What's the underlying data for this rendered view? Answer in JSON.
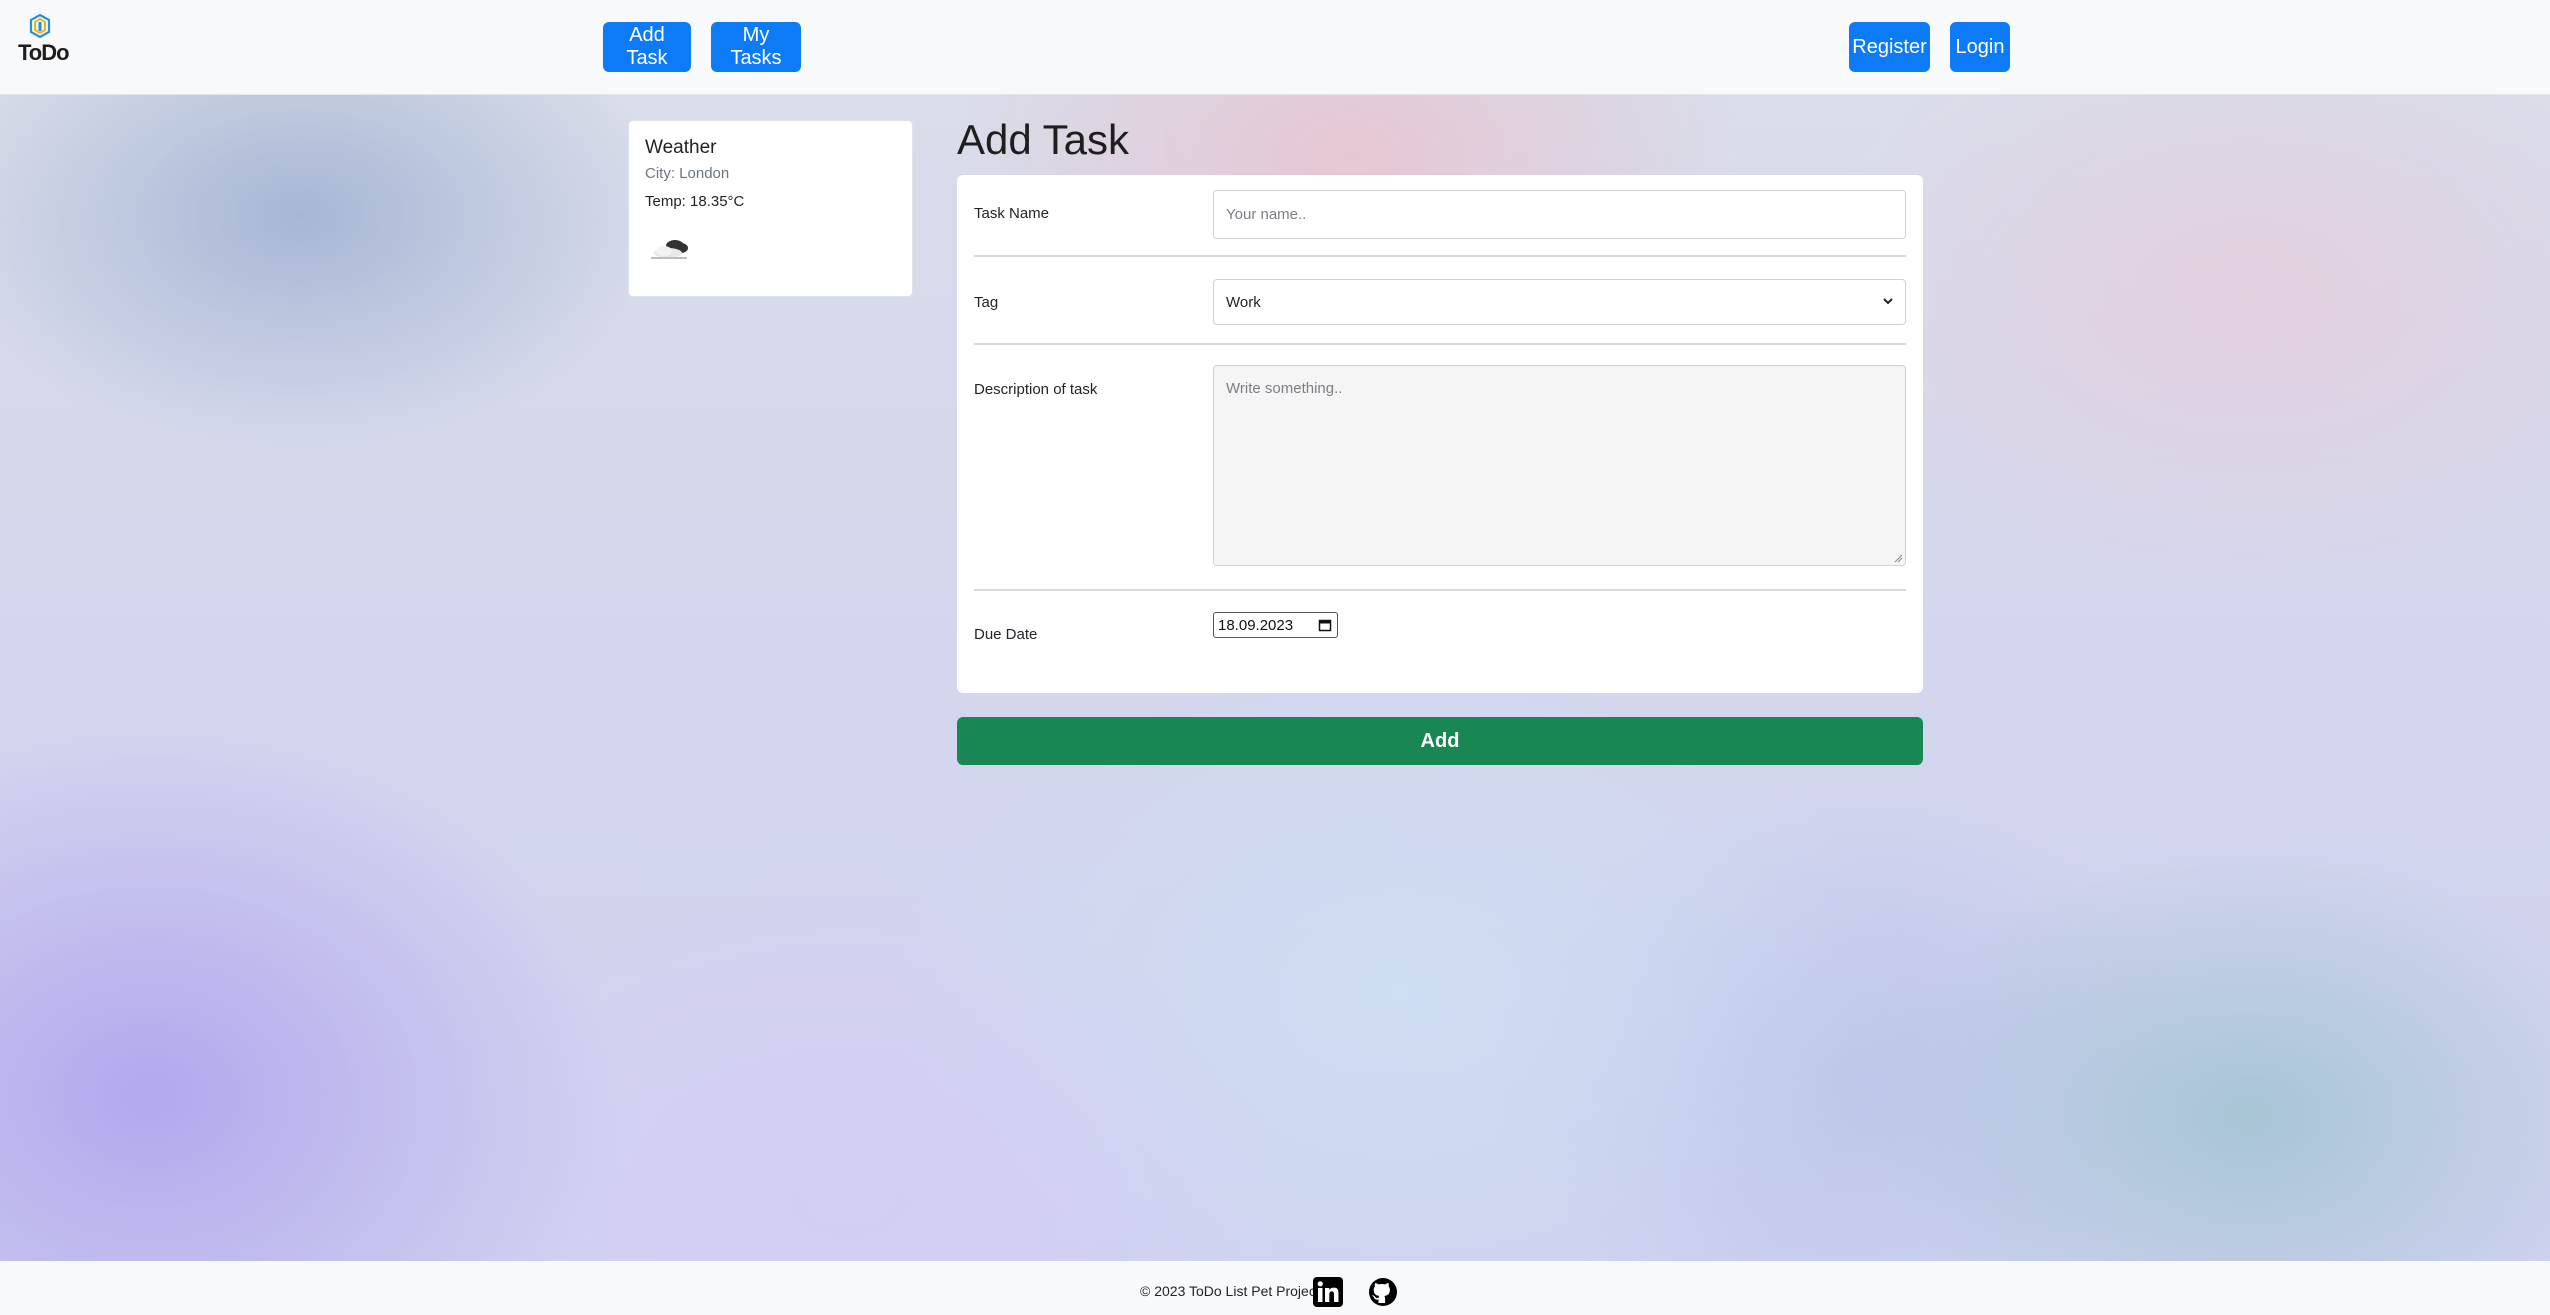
{
  "header": {
    "logo_text": "ToDo",
    "nav": {
      "add_task": "Add Task",
      "my_tasks": "My Tasks",
      "register": "Register",
      "login": "Login"
    },
    "button_color": "#0d7bf7"
  },
  "weather": {
    "title": "Weather",
    "city": "City: London",
    "temp": "Temp: 18.35°C",
    "icon": "cloud-icon"
  },
  "form": {
    "title": "Add Task",
    "task_name": {
      "label": "Task Name",
      "placeholder": "Your name.."
    },
    "tag": {
      "label": "Tag",
      "selected": "Work"
    },
    "description": {
      "label": "Description of task",
      "placeholder": "Write something.."
    },
    "due_date": {
      "label": "Due Date",
      "value": "18.09.2023"
    },
    "submit_label": "Add",
    "submit_color": "#198754"
  },
  "footer": {
    "copyright": "© 2023 ToDo List Pet Project",
    "icons": [
      "linkedin-icon",
      "github-icon"
    ]
  }
}
